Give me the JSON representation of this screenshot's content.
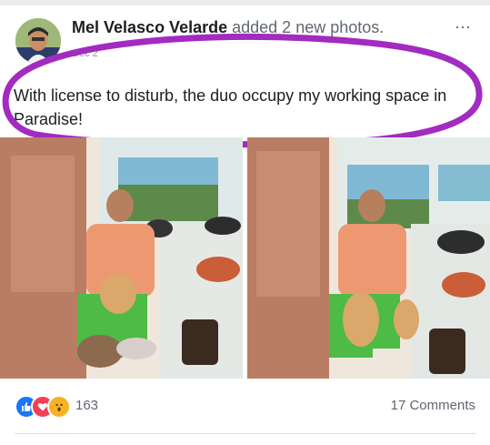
{
  "post": {
    "author": "Mel Velasco Velarde",
    "action": "added 2 new photos.",
    "meta": "Dec 2",
    "more_icon": "⋯",
    "text": "With license to disturb, the duo occupy my working space in Paradise!"
  },
  "photos": [
    {
      "icon": "photo"
    },
    {
      "icon": "photo"
    }
  ],
  "footer": {
    "reaction_icons": [
      "like-icon",
      "love-icon",
      "wow-icon"
    ],
    "reaction_count": "163",
    "comments": "17 Comments"
  },
  "colors": {
    "facebook_blue": "#1877f2",
    "love_red": "#f33e58",
    "wow_yellow": "#f7b125",
    "highlight_purple": "#a22bc0"
  }
}
